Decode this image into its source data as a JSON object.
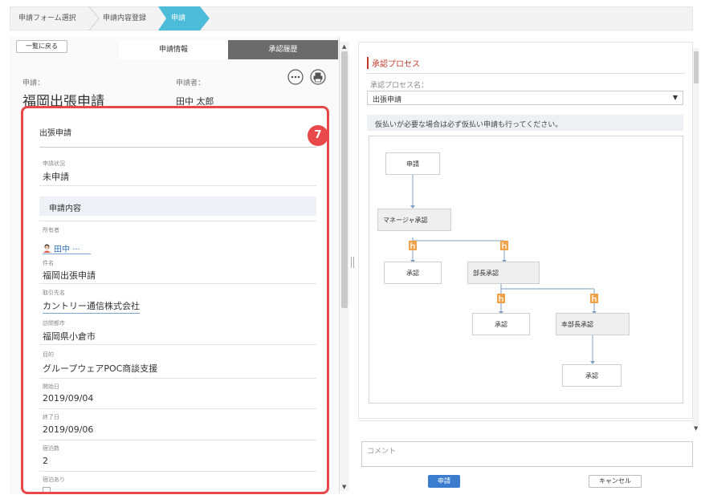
{
  "breadcrumb": {
    "items": [
      "申請フォーム選択",
      "申請内容登録",
      "申請"
    ]
  },
  "left": {
    "back_label": "一覧に戻る",
    "tabs": [
      "申請情報",
      "承認履歴"
    ],
    "app_label": "申請：",
    "app_title": "福岡出張申請",
    "applicant_label": "申請者：",
    "applicant_name": "田中 太郎",
    "icons": {
      "more": "more-icon",
      "print": "print-icon"
    }
  },
  "form": {
    "badge": "7",
    "title": "出張申請",
    "status_label": "申請状況",
    "status_value": "未申請",
    "section": "申請内容",
    "owner_label": "所有者",
    "owner_value": "田中 ···",
    "subject_label": "件名",
    "subject_value": "福岡出張申請",
    "client_label": "取引先名",
    "client_value": "カントリー通信株式会社",
    "city_label": "訪問都市",
    "city_value": "福岡県小倉市",
    "purpose_label": "目的",
    "purpose_value": "グループウェアPOC商談支援",
    "start_label": "開始日",
    "start_value": "2019/09/04",
    "end_label": "終了日",
    "end_value": "2019/09/06",
    "nights_label": "宿泊数",
    "nights_value": "2",
    "stay_label": "宿泊あり"
  },
  "process": {
    "title": "承認プロセス",
    "name_label": "承認プロセス名：",
    "selected": "出張申請",
    "note": "仮払いが必要な場合は必ず仮払い申請も行ってください。",
    "nodes": {
      "apply": "申請",
      "manager": "マネージャ承認",
      "approve1": "承認",
      "dept": "部長承認",
      "approve2": "承認",
      "hq": "本部長承認",
      "approve3": "承認"
    }
  },
  "bottom": {
    "comment_placeholder": "コメント",
    "submit": "申請",
    "cancel": "キャンセル"
  },
  "colors": {
    "accent": "#e8484a",
    "primary": "#3b7ccf",
    "breadcrumb_active": "#4dbcd8",
    "approver_icon": "#f0a24a"
  }
}
